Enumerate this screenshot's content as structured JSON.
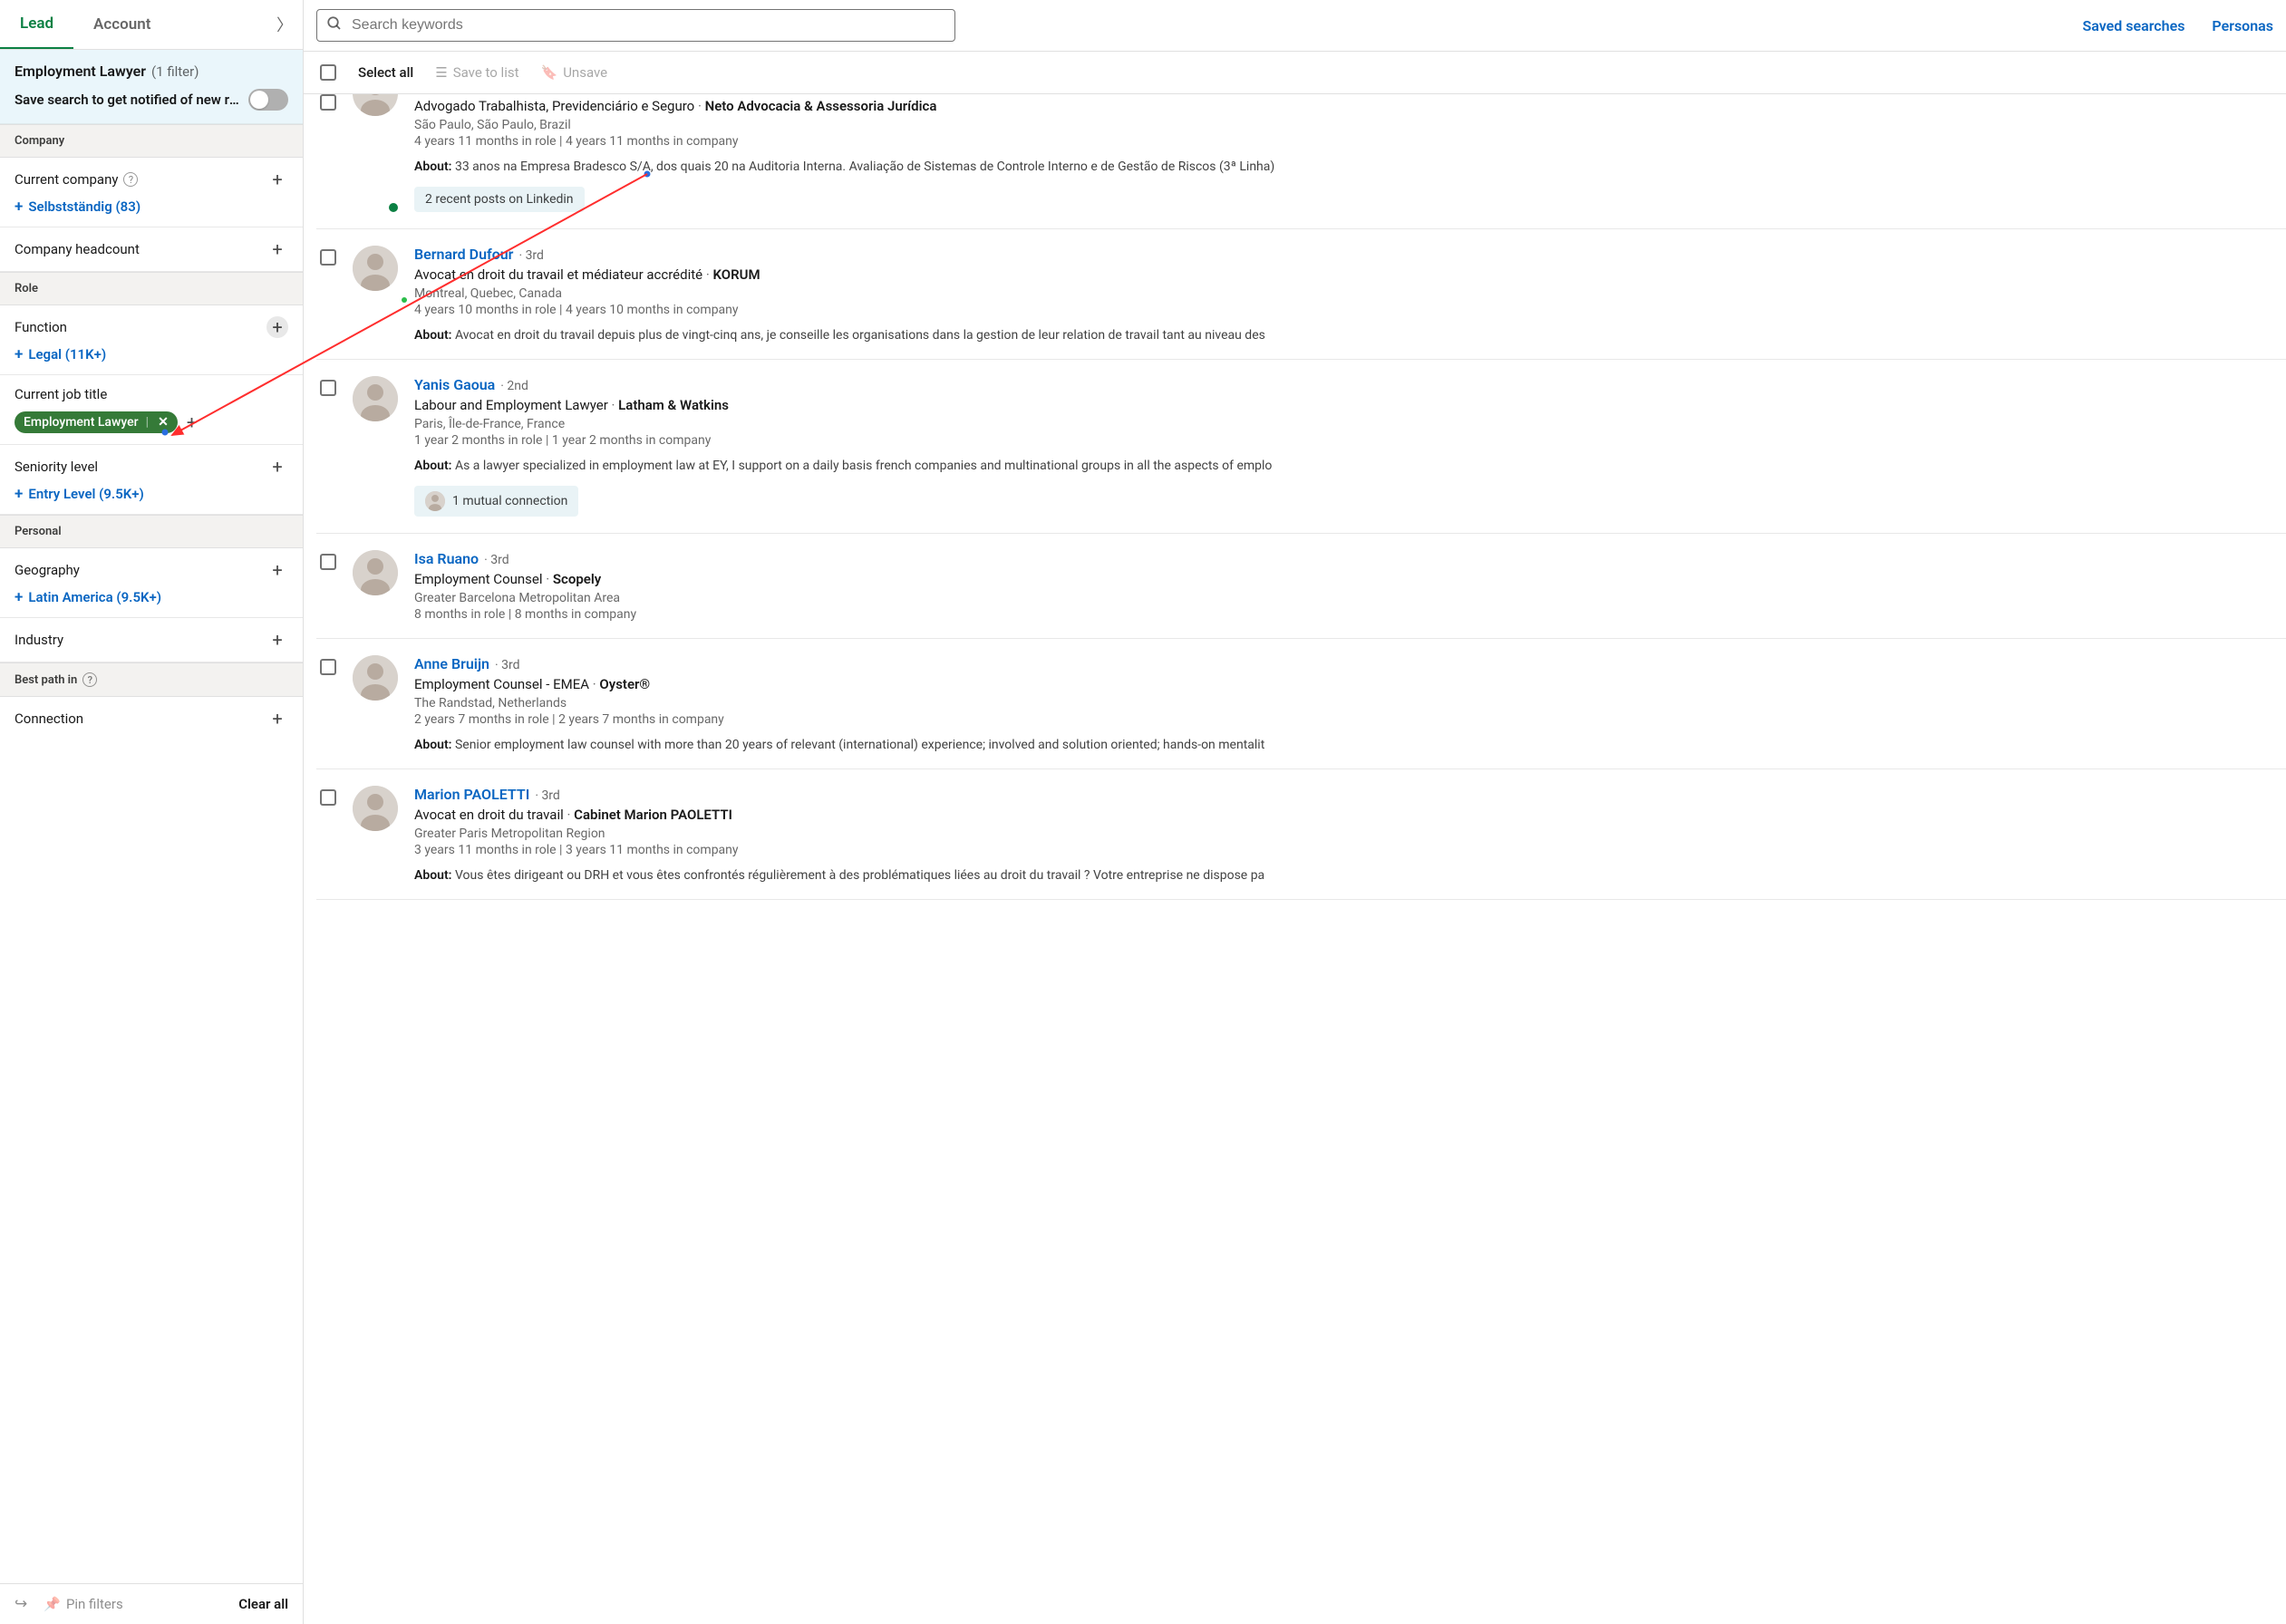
{
  "tabs": {
    "lead": "Lead",
    "account": "Account"
  },
  "summary": {
    "title": "Employment Lawyer",
    "filter_count": "(1 filter)",
    "notify": "Save search to get notified of new re..."
  },
  "sections": {
    "company": "Company",
    "role": "Role",
    "personal": "Personal",
    "best_path": "Best path in"
  },
  "filters": {
    "current_company": {
      "label": "Current company",
      "value": "Selbstständig (83)"
    },
    "headcount": {
      "label": "Company headcount"
    },
    "function": {
      "label": "Function",
      "value": "Legal (11K+)"
    },
    "current_job_title": {
      "label": "Current job title",
      "chip": "Employment Lawyer"
    },
    "seniority": {
      "label": "Seniority level",
      "value": "Entry Level (9.5K+)"
    },
    "geography": {
      "label": "Geography",
      "value": "Latin America (9.5K+)"
    },
    "industry": {
      "label": "Industry"
    },
    "connection": {
      "label": "Connection"
    }
  },
  "footer": {
    "pin": "Pin filters",
    "clear": "Clear all"
  },
  "search": {
    "placeholder": "Search keywords"
  },
  "toplinks": {
    "saved": "Saved searches",
    "personas": "Personas"
  },
  "actionbar": {
    "select_all": "Select all",
    "save_to_list": "Save to list",
    "unsave": "Unsave"
  },
  "results": [
    {
      "name": "",
      "degree": "",
      "title": "Advogado Trabalhista, Previdenciário e Seguro",
      "company": "Neto Advocacia & Assessoria Jurídica",
      "location": "São Paulo, São Paulo, Brazil",
      "tenure": "4 years 11 months in role | 4 years 11 months in company",
      "about": "33 anos na Empresa Bradesco S/A, dos quais 20 na Auditoria Interna. Avaliação de Sistemas de Controle Interno e de Gestão de Riscos (3ª Linha)",
      "badge": "2 recent posts on Linkedin",
      "partial_top": true,
      "online": true
    },
    {
      "name": "Bernard Dufour",
      "degree": "· 3rd",
      "title": "Avocat en droit du travail et médiateur accrédité",
      "company": "KORUM",
      "location": "Montreal, Quebec, Canada",
      "tenure": "4 years 10 months in role | 4 years 10 months in company",
      "about": "Avocat en droit du travail depuis plus de vingt-cinq ans, je conseille les organisations dans la gestion de leur relation de travail tant au niveau des"
    },
    {
      "name": "Yanis Gaoua",
      "degree": "· 2nd",
      "title": "Labour and Employment Lawyer",
      "company": "Latham & Watkins",
      "location": "Paris, Île-de-France, France",
      "tenure": "1 year 2 months in role | 1 year 2 months in company",
      "about": "As a lawyer specialized in employment law at EY, I support on a daily basis french companies and multinational groups in all the aspects of emplo",
      "badge": "1 mutual connection",
      "badge_avatar": true
    },
    {
      "name": "Isa Ruano",
      "degree": "· 3rd",
      "title": "Employment Counsel",
      "company": "Scopely",
      "location": "Greater Barcelona Metropolitan Area",
      "tenure": "8 months in role | 8 months in company"
    },
    {
      "name": "Anne Bruijn",
      "degree": "· 3rd",
      "title": "Employment Counsel - EMEA",
      "company": "Oyster®",
      "location": "The Randstad, Netherlands",
      "tenure": "2 years 7 months in role | 2 years 7 months in company",
      "about": "Senior employment law counsel with more than 20 years of relevant (international) experience; involved and solution oriented; hands-on mentalit"
    },
    {
      "name": "Marion PAOLETTI",
      "degree": "· 3rd",
      "title": "Avocat en droit du travail",
      "company": "Cabinet Marion PAOLETTI",
      "location": "Greater Paris Metropolitan Region",
      "tenure": "3 years 11 months in role | 3 years 11 months in company",
      "about": "Vous êtes dirigeant ou DRH et vous êtes confrontés régulièrement à des problématiques liées au droit du travail ? Votre entreprise ne dispose pa"
    }
  ],
  "about_label": "About:"
}
